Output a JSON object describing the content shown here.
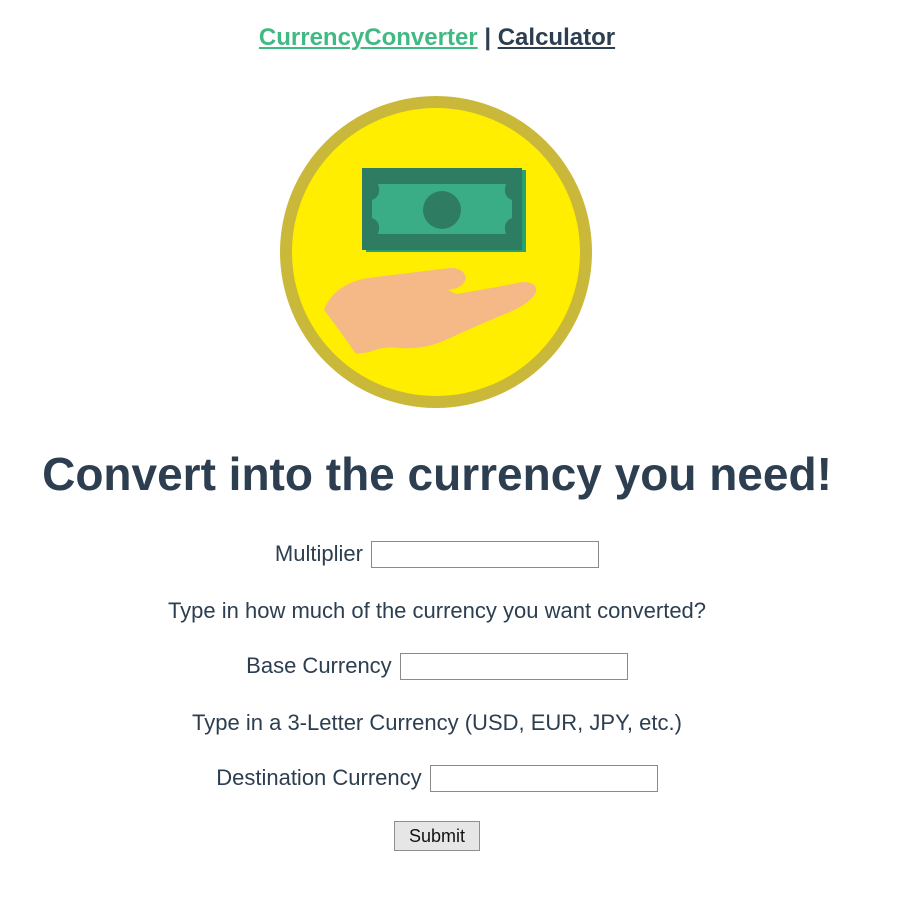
{
  "nav": {
    "links": [
      {
        "label": "CurrencyConverter",
        "active": true
      },
      {
        "label": "Calculator",
        "active": false
      }
    ],
    "separator": "|"
  },
  "logo": {
    "icon": "hand-with-money-icon",
    "colors": {
      "ring": "#c9b83a",
      "fill": "#ffee00",
      "bill": "#2e8a68",
      "bill_inner": "#3aac86",
      "hand": "#f5b887"
    }
  },
  "headline": "Convert into the currency you need!",
  "form": {
    "multiplier": {
      "label": "Multiplier",
      "value": ""
    },
    "multiplier_help": "Type in how much of the currency you want converted?",
    "base": {
      "label": "Base Currency",
      "value": ""
    },
    "base_help": "Type in a 3-Letter Currency (USD, EUR, JPY, etc.)",
    "destination": {
      "label": "Destination Currency",
      "value": ""
    },
    "submit_label": "Submit"
  },
  "colors": {
    "text": "#2c3e50",
    "accent": "#42b983"
  }
}
